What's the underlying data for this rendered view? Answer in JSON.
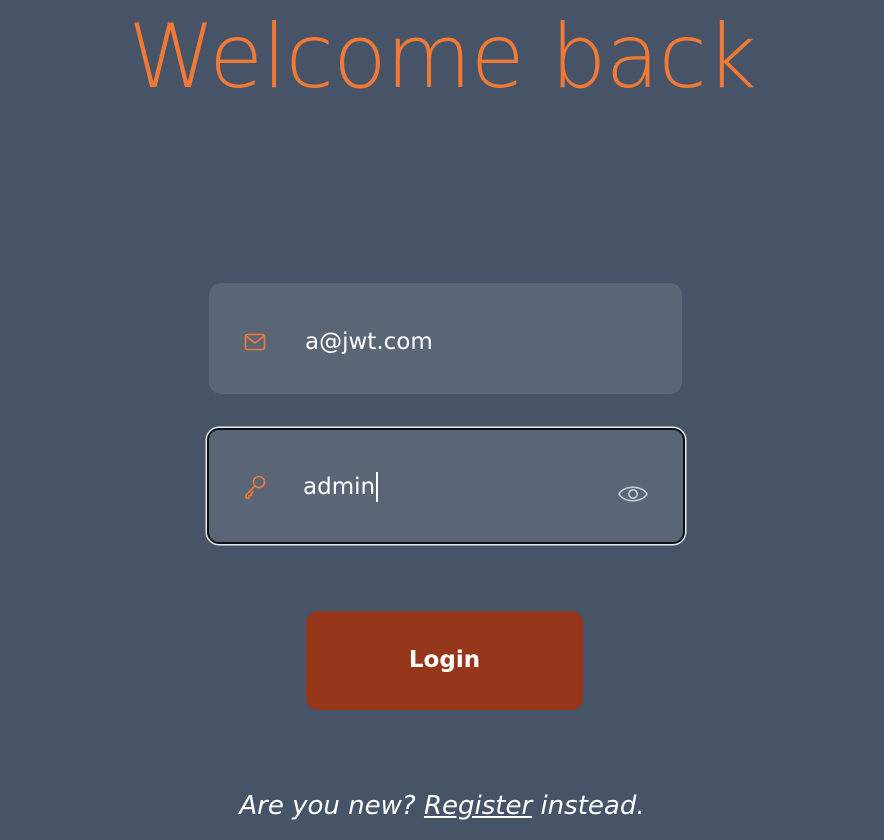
{
  "header": {
    "title": "Welcome back"
  },
  "form": {
    "email": {
      "icon": "mail-icon",
      "value": "a@jwt.com"
    },
    "password": {
      "icon": "key-icon",
      "value": "admin",
      "toggle_icon": "eye-icon"
    },
    "login_label": "Login"
  },
  "footer": {
    "prefix": "Are you new? ",
    "link_label": "Register",
    "suffix": " instead."
  },
  "colors": {
    "background": "#475467",
    "accent": "#F07A35",
    "field": "#5A6576",
    "button": "#96361B"
  }
}
